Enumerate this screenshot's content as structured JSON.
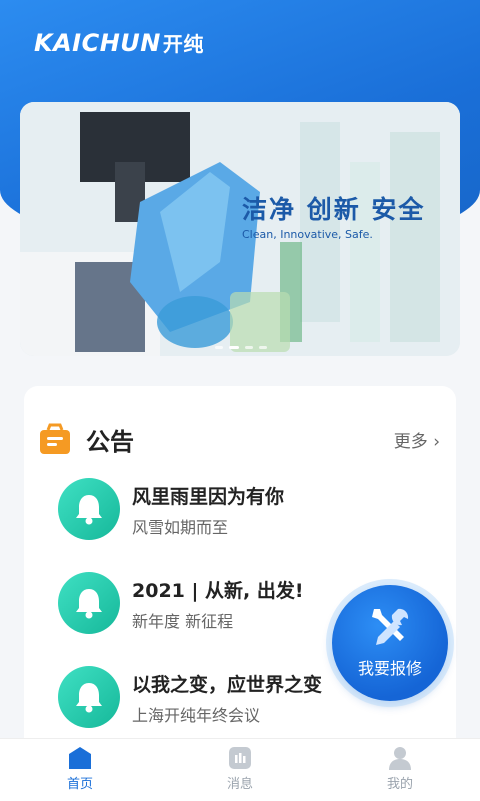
{
  "brand": {
    "name": "KAICHUN",
    "name_cn": "开纯"
  },
  "banner": {
    "slogan": "洁净  创新  安全",
    "slogan_en": "Clean, Innovative, Safe."
  },
  "notice": {
    "title": "公告",
    "more_label": "更多",
    "items": [
      {
        "title": "风里雨里因为有你",
        "subtitle": "风雪如期而至"
      },
      {
        "title": "2021 | 从新, 出发!",
        "subtitle": "新年度 新征程"
      },
      {
        "title": "以我之变，应世界之变",
        "subtitle": "上海开纯年终会议"
      }
    ]
  },
  "repair_button": {
    "label": "我要报修"
  },
  "tabs": [
    {
      "label": "首页",
      "active": true
    },
    {
      "label": "消息",
      "active": false
    },
    {
      "label": "我的",
      "active": false
    }
  ],
  "colors": {
    "primary": "#1a6fd8",
    "accent": "#16b89a",
    "notice_icon": "#f59a23",
    "inactive": "#9aa3ad"
  }
}
